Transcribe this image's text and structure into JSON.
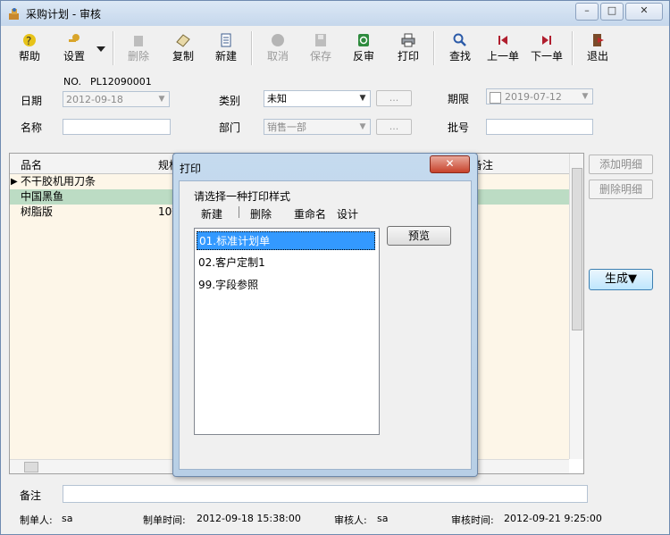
{
  "window": {
    "title": "采购计划 - 审核",
    "minimize": "–",
    "maximize": "□",
    "close": "✕"
  },
  "toolbar": {
    "help": "帮助",
    "settings": "设置",
    "delete": "删除",
    "copy": "复制",
    "new": "新建",
    "cancel": "取消",
    "save": "保存",
    "unapprove": "反审",
    "print": "打印",
    "find": "查找",
    "prev": "上一单",
    "next": "下一单",
    "exit": "退出"
  },
  "form": {
    "no_label": "NO.",
    "no_value": "PL12090001",
    "date_label": "日期",
    "date_value": "2012-09-18",
    "category_label": "类别",
    "category_value": "未知",
    "deadline_label": "期限",
    "deadline_value": "2019-07-12",
    "name_label": "名称",
    "name_value": "",
    "dept_label": "部门",
    "dept_value": "销售一部",
    "batch_label": "批号",
    "batch_value": "",
    "dots": "...",
    "arrow": "▼"
  },
  "grid": {
    "columns": [
      "品名",
      "规格",
      "备注"
    ],
    "rows": [
      {
        "name": "不干胶机用刀条",
        "spec": ""
      },
      {
        "name": "中国黑鱼",
        "spec": ""
      },
      {
        "name": "树脂版",
        "spec": "10*"
      }
    ],
    "row_pointer": "▶"
  },
  "side": {
    "add_detail": "添加明细",
    "delete_detail": "删除明细",
    "generate": "生成▼"
  },
  "remark": {
    "label": "备注",
    "value": ""
  },
  "status": {
    "creator_label": "制单人:",
    "creator": "sa",
    "created_label": "制单时间:",
    "created": "2012-09-18 15:38:00",
    "reviewer_label": "审核人:",
    "reviewer": "sa",
    "reviewed_label": "审核时间:",
    "reviewed": "2012-09-21 9:25:00"
  },
  "dialog": {
    "title": "打印",
    "close": "✕",
    "prompt": "请选择一种打印样式",
    "actions": {
      "new": "新建",
      "delete": "删除",
      "rename": "重命名",
      "design": "设计"
    },
    "styles": [
      "01.标准计划单",
      "02.客户定制1",
      "99.字段参照"
    ],
    "preview": "预览"
  }
}
